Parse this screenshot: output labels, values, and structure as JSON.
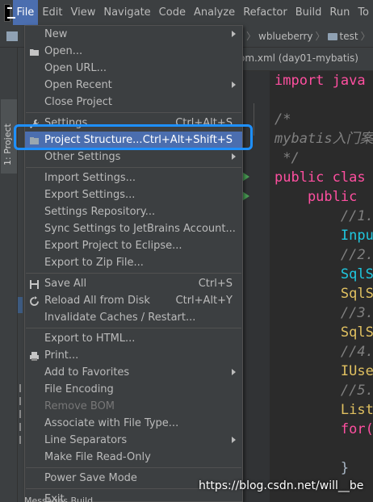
{
  "menubar": {
    "items": [
      "File",
      "Edit",
      "View",
      "Navigate",
      "Code",
      "Analyze",
      "Refactor",
      "Build",
      "Run",
      "To"
    ],
    "active": "File"
  },
  "navbar": {
    "crumb_project": "wblueberry",
    "crumb_folder": "test"
  },
  "toolwindow": {
    "project_tab": "1: Project"
  },
  "editor": {
    "tab_title": "om.xml (day01-mybatis)",
    "code_lines": [
      {
        "text": "import java",
        "cls": "pink"
      },
      {
        "text": "",
        "cls": "ty"
      },
      {
        "text": "/*",
        "cls": "cm"
      },
      {
        "text": "mybatis入门案",
        "cls": "cm"
      },
      {
        "text": " */",
        "cls": "cm"
      },
      {
        "text": "public clas",
        "cls": "pink"
      },
      {
        "text": "    public",
        "cls": "pink"
      },
      {
        "text": "        //1.",
        "cls": "cm"
      },
      {
        "text": "        Inpu",
        "cls": "cyan"
      },
      {
        "text": "        //2.",
        "cls": "cm"
      },
      {
        "text": "        SqlS",
        "cls": "cyan"
      },
      {
        "text": "        SqlS",
        "cls": "yel"
      },
      {
        "text": "        //3.",
        "cls": "cm"
      },
      {
        "text": "        SqlS",
        "cls": "yel"
      },
      {
        "text": "        //4.",
        "cls": "cm"
      },
      {
        "text": "        IUse",
        "cls": "yel"
      },
      {
        "text": "        //5.",
        "cls": "cm"
      },
      {
        "text": "        List",
        "cls": "yel"
      },
      {
        "text": "        for(",
        "cls": "pink"
      },
      {
        "text": "",
        "cls": "ty"
      },
      {
        "text": "        }",
        "cls": "ty"
      }
    ]
  },
  "file_menu": {
    "items": [
      {
        "label": "New",
        "shortcut": "",
        "submenu": true,
        "disabled": false,
        "selected": false,
        "icon": ""
      },
      {
        "label": "Open...",
        "shortcut": "",
        "submenu": false,
        "disabled": false,
        "selected": false,
        "icon": "folder-open-icon"
      },
      {
        "label": "Open URL...",
        "shortcut": "",
        "submenu": false,
        "disabled": false,
        "selected": false,
        "icon": ""
      },
      {
        "label": "Open Recent",
        "shortcut": "",
        "submenu": true,
        "disabled": false,
        "selected": false,
        "icon": ""
      },
      {
        "label": "Close Project",
        "shortcut": "",
        "submenu": false,
        "disabled": false,
        "selected": false,
        "icon": ""
      },
      {
        "sep": true
      },
      {
        "label": "Settings...",
        "shortcut": "Ctrl+Alt+S",
        "submenu": false,
        "disabled": false,
        "selected": false,
        "icon": "wrench-icon"
      },
      {
        "label": "Project Structure...",
        "shortcut": "Ctrl+Alt+Shift+S",
        "submenu": false,
        "disabled": false,
        "selected": true,
        "icon": "project-structure-icon"
      },
      {
        "label": "Other Settings",
        "shortcut": "",
        "submenu": true,
        "disabled": false,
        "selected": false,
        "icon": ""
      },
      {
        "sep": true
      },
      {
        "label": "Import Settings...",
        "shortcut": "",
        "submenu": false,
        "disabled": false,
        "selected": false,
        "icon": ""
      },
      {
        "label": "Export Settings...",
        "shortcut": "",
        "submenu": false,
        "disabled": false,
        "selected": false,
        "icon": ""
      },
      {
        "label": "Settings Repository...",
        "shortcut": "",
        "submenu": false,
        "disabled": false,
        "selected": false,
        "icon": ""
      },
      {
        "label": "Sync Settings to JetBrains Account...",
        "shortcut": "",
        "submenu": false,
        "disabled": false,
        "selected": false,
        "icon": ""
      },
      {
        "label": "Export Project to Eclipse...",
        "shortcut": "",
        "submenu": false,
        "disabled": false,
        "selected": false,
        "icon": ""
      },
      {
        "label": "Export to Zip File...",
        "shortcut": "",
        "submenu": false,
        "disabled": false,
        "selected": false,
        "icon": ""
      },
      {
        "sep": true
      },
      {
        "label": "Save All",
        "shortcut": "Ctrl+S",
        "submenu": false,
        "disabled": false,
        "selected": false,
        "icon": "save-icon"
      },
      {
        "label": "Reload All from Disk",
        "shortcut": "Ctrl+Alt+Y",
        "submenu": false,
        "disabled": false,
        "selected": false,
        "icon": "reload-icon"
      },
      {
        "label": "Invalidate Caches / Restart...",
        "shortcut": "",
        "submenu": false,
        "disabled": false,
        "selected": false,
        "icon": ""
      },
      {
        "sep": true
      },
      {
        "label": "Export to HTML...",
        "shortcut": "",
        "submenu": false,
        "disabled": false,
        "selected": false,
        "icon": ""
      },
      {
        "label": "Print...",
        "shortcut": "",
        "submenu": false,
        "disabled": false,
        "selected": false,
        "icon": "print-icon"
      },
      {
        "label": "Add to Favorites",
        "shortcut": "",
        "submenu": true,
        "disabled": false,
        "selected": false,
        "icon": ""
      },
      {
        "label": "File Encoding",
        "shortcut": "",
        "submenu": false,
        "disabled": false,
        "selected": false,
        "icon": ""
      },
      {
        "label": "Remove BOM",
        "shortcut": "",
        "submenu": false,
        "disabled": true,
        "selected": false,
        "icon": ""
      },
      {
        "label": "Associate with File Type...",
        "shortcut": "",
        "submenu": false,
        "disabled": false,
        "selected": false,
        "icon": ""
      },
      {
        "label": "Line Separators",
        "shortcut": "",
        "submenu": true,
        "disabled": false,
        "selected": false,
        "icon": ""
      },
      {
        "label": "Make File Read-Only",
        "shortcut": "",
        "submenu": false,
        "disabled": false,
        "selected": false,
        "icon": ""
      },
      {
        "sep": true
      },
      {
        "label": "Power Save Mode",
        "shortcut": "",
        "submenu": false,
        "disabled": false,
        "selected": false,
        "icon": ""
      },
      {
        "sep": true
      },
      {
        "label": "Exit",
        "shortcut": "",
        "submenu": false,
        "disabled": false,
        "selected": false,
        "icon": ""
      }
    ]
  },
  "watermark": "https://blog.csdn.net/will__be",
  "bottom": {
    "tabs": "Messages   Build"
  },
  "colors": {
    "selection": "#4b6eaf",
    "highlight_box": "#1e90ff",
    "menu_bg": "#3c3f41"
  }
}
